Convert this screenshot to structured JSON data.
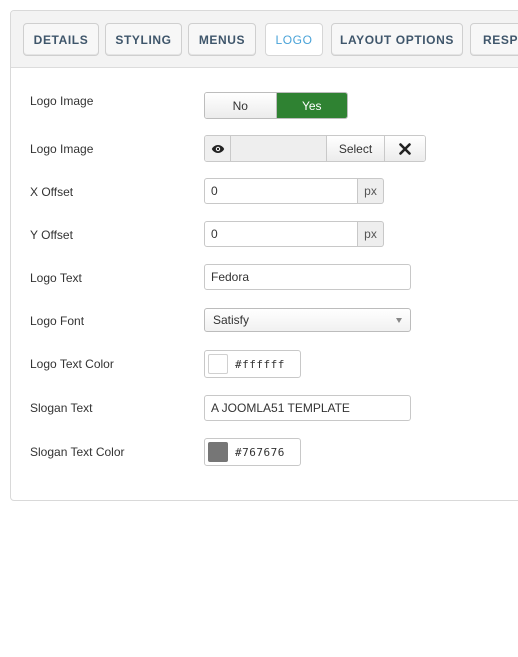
{
  "tabs": [
    {
      "label": "DETAILS"
    },
    {
      "label": "STYLING"
    },
    {
      "label": "MENUS"
    },
    {
      "label": "LOGO"
    },
    {
      "label": "LAYOUT OPTIONS"
    },
    {
      "label": "RESPO"
    }
  ],
  "active_tab": "LOGO",
  "form": {
    "logo_image_toggle": {
      "label": "Logo Image",
      "off_label": "No",
      "on_label": "Yes",
      "value": "Yes"
    },
    "logo_image_media": {
      "label": "Logo Image",
      "value": "",
      "select_label": "Select",
      "preview_icon": "eye-icon",
      "clear_icon": "close-icon"
    },
    "x_offset": {
      "label": "X Offset",
      "value": "0",
      "unit": "px"
    },
    "y_offset": {
      "label": "Y Offset",
      "value": "0",
      "unit": "px"
    },
    "logo_text": {
      "label": "Logo Text",
      "value": "Fedora"
    },
    "logo_font": {
      "label": "Logo Font",
      "value": "Satisfy"
    },
    "logo_text_color": {
      "label": "Logo Text Color",
      "value": "#ffffff",
      "swatch": "#ffffff"
    },
    "slogan_text": {
      "label": "Slogan Text",
      "value": "A JOOMLA51 TEMPLATE"
    },
    "slogan_text_color": {
      "label": "Slogan Text Color",
      "value": "#767676",
      "swatch": "#767676"
    }
  },
  "colors": {
    "accent_active_tab": "#4aa3d8",
    "toggle_on": "#2f8232",
    "tab_text": "#3f566b"
  }
}
